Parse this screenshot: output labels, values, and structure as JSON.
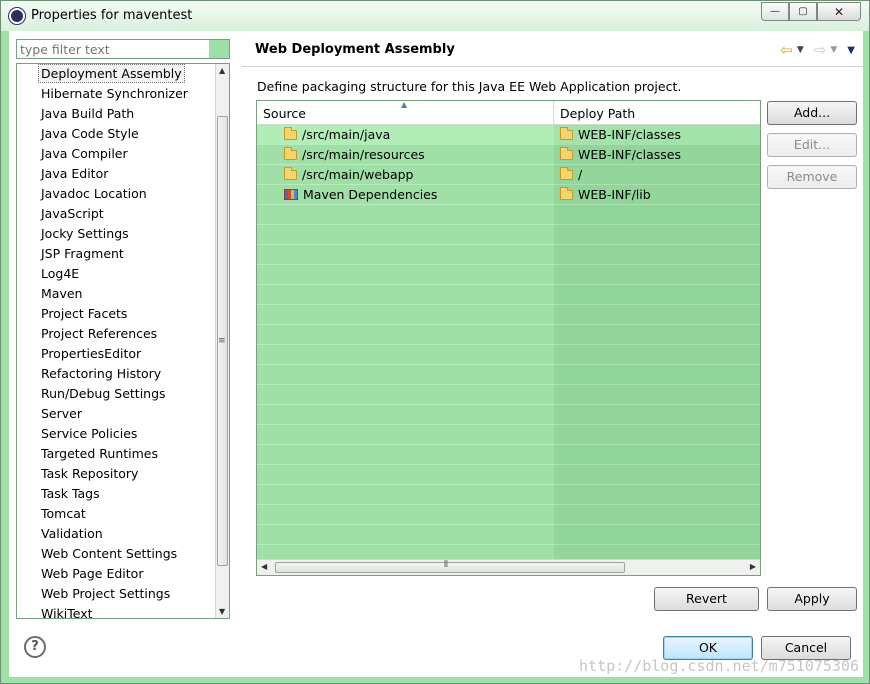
{
  "window": {
    "title": "Properties for maventest",
    "controls": {
      "minimize": "—",
      "maximize": "▢",
      "close": "✕"
    }
  },
  "filter": {
    "placeholder": "type filter text"
  },
  "tree": {
    "items": [
      "Deployment Assembly",
      "Hibernate Synchronizer",
      "Java Build Path",
      "Java Code Style",
      "Java Compiler",
      "Java Editor",
      "Javadoc Location",
      "JavaScript",
      "Jocky Settings",
      "JSP Fragment",
      "Log4E",
      "Maven",
      "Project Facets",
      "Project References",
      "PropertiesEditor",
      "Refactoring History",
      "Run/Debug Settings",
      "Server",
      "Service Policies",
      "Targeted Runtimes",
      "Task Repository",
      "Task Tags",
      "Tomcat",
      "Validation",
      "Web Content Settings",
      "Web Page Editor",
      "Web Project Settings",
      "WikiText"
    ],
    "selected": "Deployment Assembly"
  },
  "page": {
    "title": "Web Deployment Assembly",
    "description": "Define packaging structure for this Java EE Web Application project."
  },
  "table": {
    "columns": {
      "source": "Source",
      "deploy": "Deploy Path"
    },
    "rows": [
      {
        "source": "/src/main/java",
        "deploy": "WEB-INF/classes",
        "icon": "folder-icon"
      },
      {
        "source": "/src/main/resources",
        "deploy": "WEB-INF/classes",
        "icon": "folder-icon"
      },
      {
        "source": "/src/main/webapp",
        "deploy": "/",
        "icon": "folder-icon"
      },
      {
        "source": "Maven Dependencies",
        "deploy": "WEB-INF/lib",
        "icon": "library-icon"
      }
    ]
  },
  "buttons": {
    "add": "Add...",
    "edit": "Edit...",
    "remove": "Remove",
    "revert": "Revert",
    "apply": "Apply",
    "ok": "OK",
    "cancel": "Cancel"
  },
  "help": {
    "glyph": "?"
  },
  "watermark": "http://blog.csdn.net/m751075306",
  "colors": {
    "background_tint": "#9fe0a7",
    "default_button": "#bee6fd"
  }
}
